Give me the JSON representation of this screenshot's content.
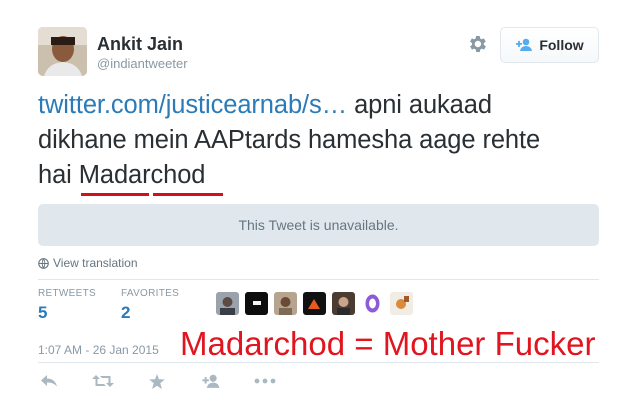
{
  "author": {
    "name": "Ankit Jain",
    "handle": "@indiantweeter"
  },
  "header": {
    "settings_icon": "gear-icon",
    "follow_icon": "follow-user-icon",
    "follow_label": "Follow"
  },
  "tweet": {
    "link_text": "twitter.com/justicearnab/s…",
    "line1_rest": " apni aukaad",
    "line2": "dikhane mein AAPtards hamesha aage rehte",
    "line3_prefix": "hai ",
    "highlighted_word": "Madarchod",
    "unavailable_text": "This Tweet is unavailable.",
    "view_translation": "View translation"
  },
  "stats": {
    "retweets_label": "RETWEETS",
    "retweets_value": "5",
    "favorites_label": "FAVORITES",
    "favorites_value": "2"
  },
  "timestamp": "1:07 AM - 26 Jan 2015",
  "annotation": "Madarchod = Mother Fucker",
  "colors": {
    "link": "#2b7bb9",
    "annotation": "#e0151f",
    "muted": "#8899a6"
  },
  "actions": [
    "reply-icon",
    "retweet-icon",
    "favorite-icon",
    "follow-icon",
    "more-icon"
  ]
}
